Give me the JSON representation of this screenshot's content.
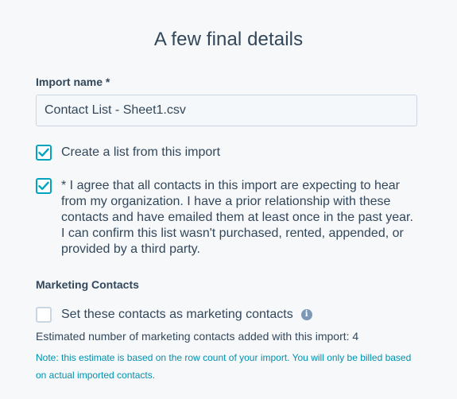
{
  "title": "A few final details",
  "import_name": {
    "label": "Import name *",
    "value": "Contact List - Sheet1.csv"
  },
  "options": {
    "create_list": {
      "checked": true,
      "label": "Create a list from this import"
    },
    "agree": {
      "checked": true,
      "label": "* I agree that all contacts in this import are expecting to hear from my organization. I have a prior relationship with these contacts and have emailed them at least once in the past year. I can confirm this list wasn't purchased, rented, appended, or provided by a third party."
    }
  },
  "marketing": {
    "section_label": "Marketing Contacts",
    "set_marketing": {
      "checked": false,
      "label": "Set these contacts as marketing contacts",
      "info_icon": "i"
    },
    "estimate_text": "Estimated number of marketing contacts added with this import: 4",
    "note_text": "Note: this estimate is based on the row count of your import. You will only be billed based on actual imported contacts."
  },
  "colors": {
    "accent": "#00a4bd",
    "text": "#33475b",
    "note": "#0091ae",
    "info_icon": "#7c98b6"
  },
  "icons": {
    "checkmark": "checkmark-icon",
    "info": "info-icon"
  }
}
